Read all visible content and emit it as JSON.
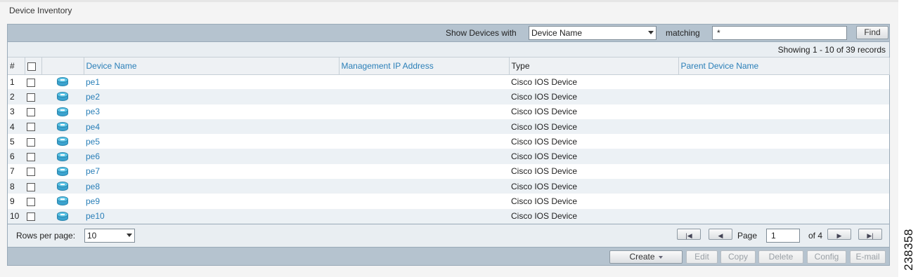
{
  "page_title": "Device Inventory",
  "search": {
    "show_label": "Show Devices with",
    "field_value": "Device Name",
    "matching_label": "matching",
    "match_value": "*",
    "find_label": "Find"
  },
  "records_text": "Showing 1 - 10 of 39 records",
  "columns": {
    "num": "#",
    "device_name": "Device Name",
    "mgmt_ip": "Management IP Address",
    "type": "Type",
    "parent": "Parent Device Name"
  },
  "rows": [
    {
      "num": "1",
      "name": "pe1",
      "ip": "",
      "type": "Cisco IOS Device",
      "parent": ""
    },
    {
      "num": "2",
      "name": "pe2",
      "ip": "",
      "type": "Cisco IOS Device",
      "parent": ""
    },
    {
      "num": "3",
      "name": "pe3",
      "ip": "",
      "type": "Cisco IOS Device",
      "parent": ""
    },
    {
      "num": "4",
      "name": "pe4",
      "ip": "",
      "type": "Cisco IOS Device",
      "parent": ""
    },
    {
      "num": "5",
      "name": "pe5",
      "ip": "",
      "type": "Cisco IOS Device",
      "parent": ""
    },
    {
      "num": "6",
      "name": "pe6",
      "ip": "",
      "type": "Cisco IOS Device",
      "parent": ""
    },
    {
      "num": "7",
      "name": "pe7",
      "ip": "",
      "type": "Cisco IOS Device",
      "parent": ""
    },
    {
      "num": "8",
      "name": "pe8",
      "ip": "",
      "type": "Cisco IOS Device",
      "parent": ""
    },
    {
      "num": "9",
      "name": "pe9",
      "ip": "",
      "type": "Cisco IOS Device",
      "parent": ""
    },
    {
      "num": "10",
      "name": "pe10",
      "ip": "",
      "type": "Cisco IOS Device",
      "parent": ""
    }
  ],
  "pagination": {
    "rows_per_page_label": "Rows per page:",
    "rows_per_page_value": "10",
    "page_label": "Page",
    "page_value": "1",
    "of_label": "of 4"
  },
  "actions": {
    "create": "Create",
    "edit": "Edit",
    "copy": "Copy",
    "delete": "Delete",
    "config": "Config",
    "email": "E-mail"
  },
  "side_number": "238358",
  "icons": {
    "device": "router-icon",
    "first": "first-page-icon",
    "prev": "prev-page-icon",
    "next": "next-page-icon",
    "last": "last-page-icon"
  },
  "colors": {
    "header_bar": "#b5c3cf",
    "link": "#2a7fb8",
    "row_alt": "#ecf1f5",
    "device_icon": "#3aa3cf"
  }
}
